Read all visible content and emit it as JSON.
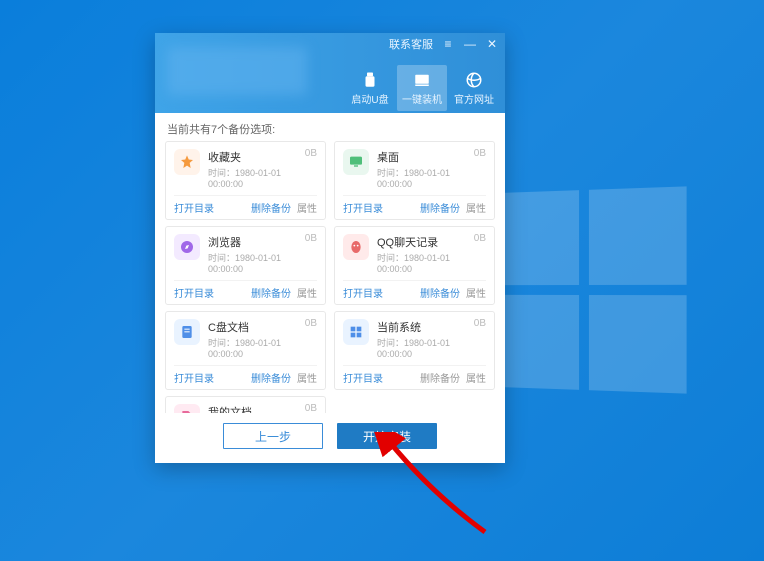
{
  "topbar": {
    "contact_label": "联系客服"
  },
  "nav": {
    "items": [
      {
        "label": "启动U盘"
      },
      {
        "label": "一键装机"
      },
      {
        "label": "官方网址"
      }
    ]
  },
  "info": {
    "backup_count_text": "当前共有7个备份选项:"
  },
  "card_labels": {
    "open_dir": "打开目录",
    "delete_backup": "删除备份",
    "properties": "属性",
    "time_prefix": "时间："
  },
  "timestamp": "1980-01-01 00:00:00",
  "size_zero": "0B",
  "items": [
    {
      "title": "收藏夹",
      "icon": "star",
      "bg": "#fff3ea",
      "fg": "#f59a3e"
    },
    {
      "title": "桌面",
      "icon": "desktop",
      "bg": "#e9f7ef",
      "fg": "#4fbf7a"
    },
    {
      "title": "浏览器",
      "icon": "compass",
      "bg": "#f3eaff",
      "fg": "#a068e8"
    },
    {
      "title": "QQ聊天记录",
      "icon": "qq",
      "bg": "#ffeaea",
      "fg": "#e86a6a"
    },
    {
      "title": "C盘文档",
      "icon": "doc",
      "bg": "#e9f3ff",
      "fg": "#4f8fe8"
    },
    {
      "title": "当前系统",
      "icon": "win",
      "bg": "#e9f3ff",
      "fg": "#4f8fe8"
    },
    {
      "title": "我的文档",
      "icon": "file",
      "bg": "#ffeaf2",
      "fg": "#e86a9b"
    }
  ],
  "footer": {
    "prev_label": "上一步",
    "install_label": "开始安装"
  }
}
